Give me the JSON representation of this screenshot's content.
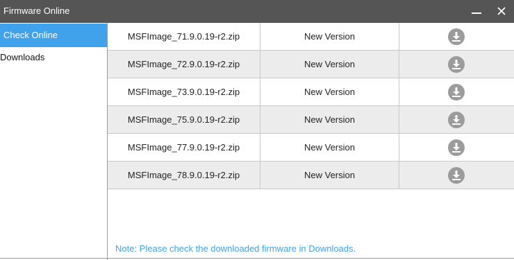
{
  "window": {
    "title": "Firmware Online"
  },
  "titlebar": {
    "minimize_icon": "minimize-icon",
    "close_icon": "close-icon"
  },
  "sidebar": {
    "items": [
      {
        "label": "Check Online",
        "active": true
      },
      {
        "label": "Downloads",
        "active": false
      }
    ]
  },
  "firmware_list": {
    "rows": [
      {
        "filename": "MSFImage_71.9.0.19-r2.zip",
        "status": "New Version",
        "action_icon": "download-icon"
      },
      {
        "filename": "MSFImage_72.9.0.19-r2.zip",
        "status": "New Version",
        "action_icon": "download-icon"
      },
      {
        "filename": "MSFImage_73.9.0.19-r2.zip",
        "status": "New Version",
        "action_icon": "download-icon"
      },
      {
        "filename": "MSFImage_75.9.0.19-r2.zip",
        "status": "New Version",
        "action_icon": "download-icon"
      },
      {
        "filename": "MSFImage_77.9.0.19-r2.zip",
        "status": "New Version",
        "action_icon": "download-icon"
      },
      {
        "filename": "MSFImage_78.9.0.19-r2.zip",
        "status": "New Version",
        "action_icon": "download-icon"
      }
    ]
  },
  "footer": {
    "note": "Note: Please check the downloaded firmware in Downloads."
  },
  "colors": {
    "titlebar": "#555555",
    "accent": "#3fa2ea",
    "alt_row": "#ececec",
    "icon_gray": "#9b9b9b"
  }
}
